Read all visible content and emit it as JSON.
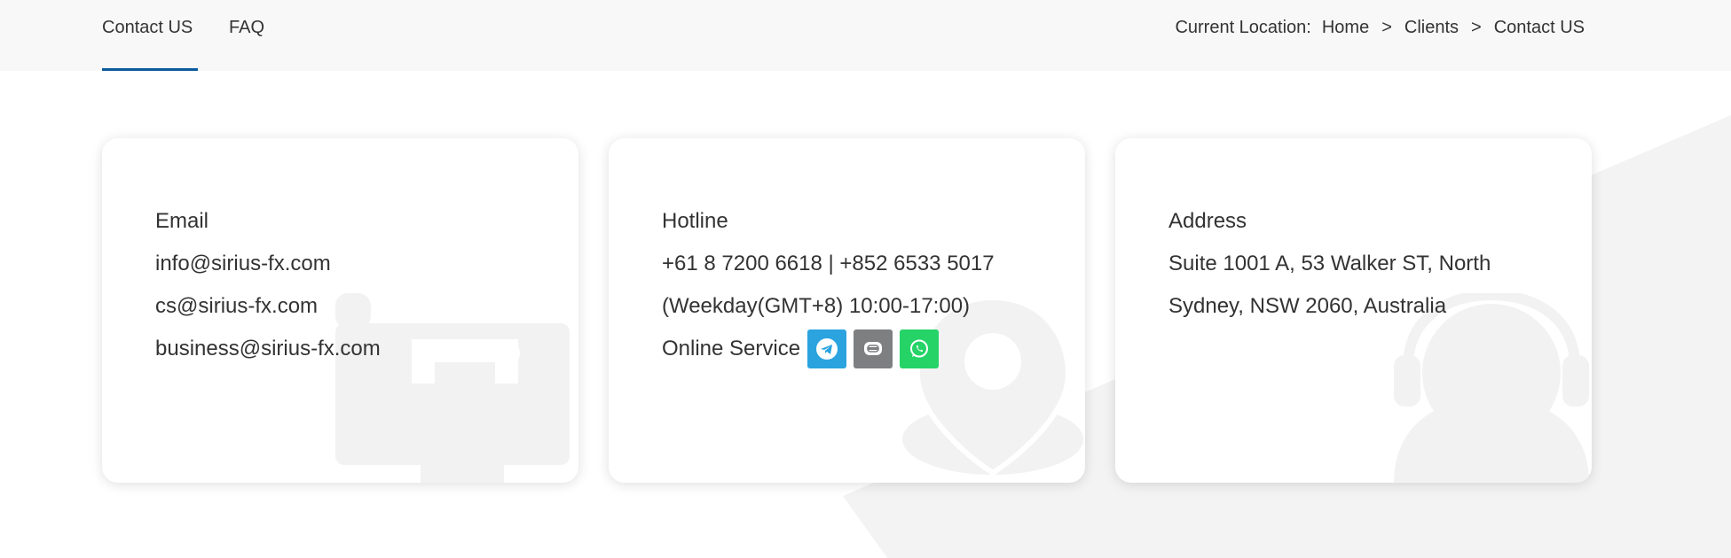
{
  "nav": {
    "tabs": [
      {
        "label": "Contact US",
        "active": true
      },
      {
        "label": "FAQ",
        "active": false
      }
    ],
    "active_color": "#0c5a9e"
  },
  "breadcrumb": {
    "prefix": "Current Location:",
    "separator": ">",
    "items": [
      "Home",
      "Clients",
      "Contact US"
    ]
  },
  "cards": {
    "email": {
      "title": "Email",
      "lines": [
        "info@sirius-fx.com",
        "cs@sirius-fx.com",
        "business@sirius-fx.com"
      ],
      "watermark_icon": "mailbox-icon"
    },
    "hotline": {
      "title": "Hotline",
      "phones": "+61 8 7200 6618 | +852 6533 5017",
      "hours": "(Weekday(GMT+8) 10:00-17:00)",
      "online_label": "Online Service",
      "social": [
        {
          "icon": "telegram-icon",
          "color": "#2aa3df"
        },
        {
          "icon": "line-icon",
          "color": "#7d7f81"
        },
        {
          "icon": "whatsapp-icon",
          "color": "#25d366"
        }
      ],
      "watermark_icon": "location-pin-icon"
    },
    "address": {
      "title": "Address",
      "lines": [
        "Suite 1001 A, 53 Walker ST, North",
        "Sydney, NSW 2060, Australia"
      ],
      "watermark_icon": "headset-agent-icon"
    }
  }
}
